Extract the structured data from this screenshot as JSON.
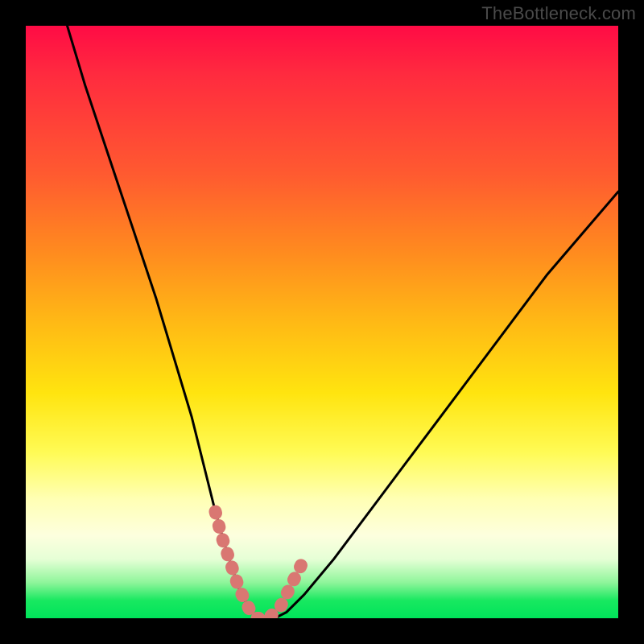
{
  "watermark": {
    "text": "TheBottleneck.com"
  },
  "colors": {
    "background": "#000000",
    "gradient_top": "#ff0b45",
    "gradient_mid": "#ffe40f",
    "gradient_bottom": "#00e45a",
    "curve": "#000000",
    "marker": "#d97772"
  },
  "chart_data": {
    "type": "line",
    "title": "",
    "xlabel": "",
    "ylabel": "",
    "xlim": [
      0,
      100
    ],
    "ylim": [
      0,
      100
    ],
    "grid": false,
    "legend": false,
    "annotations": [],
    "series": [
      {
        "name": "bottleneck-curve",
        "x": [
          7,
          10,
          14,
          18,
          22,
          25,
          28,
          30,
          32,
          34,
          36,
          38,
          40,
          42,
          44,
          47,
          52,
          58,
          64,
          70,
          76,
          82,
          88,
          94,
          100
        ],
        "values": [
          100,
          90,
          78,
          66,
          54,
          44,
          34,
          26,
          18,
          11,
          5,
          1,
          0,
          0,
          1,
          4,
          10,
          18,
          26,
          34,
          42,
          50,
          58,
          65,
          72
        ]
      }
    ],
    "markers": {
      "name": "highlighted-range",
      "x": [
        32,
        33,
        34,
        35,
        36,
        37,
        38,
        39,
        40,
        41,
        42,
        43,
        44,
        45,
        46,
        47
      ],
      "values": [
        18,
        14,
        11,
        8,
        5,
        3,
        1,
        0,
        0,
        0,
        1,
        2,
        4,
        6,
        8,
        10
      ]
    }
  }
}
